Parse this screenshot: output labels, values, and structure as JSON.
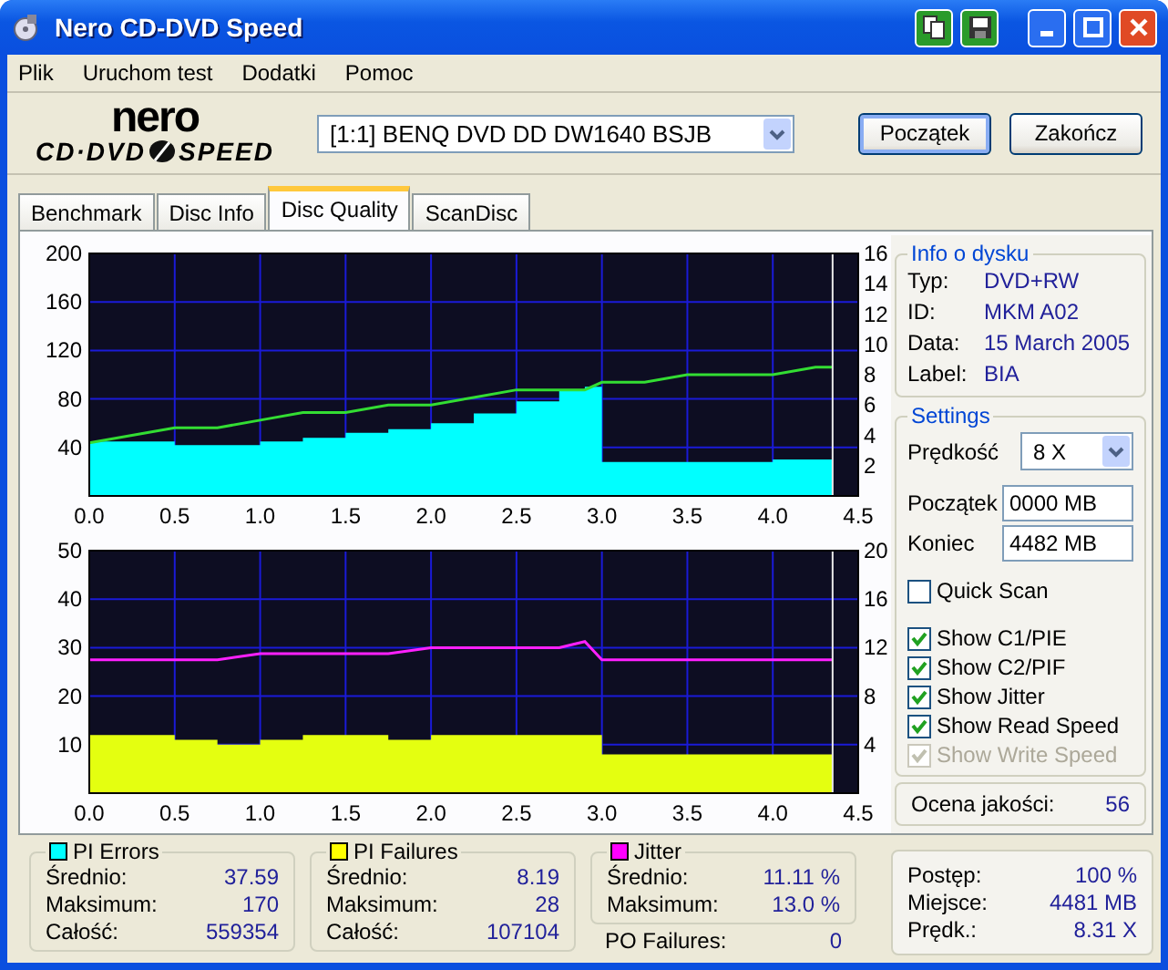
{
  "window": {
    "title": "Nero CD-DVD Speed"
  },
  "menu": [
    "Plik",
    "Uruchom test",
    "Dodatki",
    "Pomoc"
  ],
  "logo": {
    "top": "nero",
    "left": "CD·DVD",
    "right": "SPEED"
  },
  "drive": "[1:1]   BENQ DVD DD DW1640 BSJB",
  "buttons": [
    "Początek",
    "Zakończ"
  ],
  "tabs": [
    {
      "label": "Benchmark",
      "selected": false
    },
    {
      "label": "Disc Info",
      "selected": false
    },
    {
      "label": "Disc Quality",
      "selected": true
    },
    {
      "label": "ScanDisc",
      "selected": false
    }
  ],
  "charts": [
    {
      "chart_data": {
        "type": "area",
        "x": [
          0,
          0.25,
          0.5,
          0.75,
          1,
          1.25,
          1.5,
          1.75,
          2,
          2.25,
          2.5,
          2.75,
          2.9,
          3,
          3.25,
          3.5,
          3.75,
          4,
          4.25,
          4.35
        ],
        "xlim": [
          0,
          4.5
        ],
        "ylim": [
          0,
          200
        ],
        "y2lim": [
          0,
          16
        ],
        "xticks": [
          {
            "value": 0,
            "label": "0.0"
          },
          {
            "value": 0.5,
            "label": "0.5"
          },
          {
            "value": 1,
            "label": "1.0"
          },
          {
            "value": 1.5,
            "label": "1.5"
          },
          {
            "value": 2,
            "label": "2.0"
          },
          {
            "value": 2.5,
            "label": "2.5"
          },
          {
            "value": 3,
            "label": "3.0"
          },
          {
            "value": 3.5,
            "label": "3.5"
          },
          {
            "value": 4,
            "label": "4.0"
          },
          {
            "value": 4.5,
            "label": "4.5"
          }
        ],
        "yticks": [
          40,
          80,
          120,
          160,
          200
        ],
        "grid": true,
        "ref_lines": [
          {
            "axis": "x",
            "value": 4.35,
            "color": "#e8e8e8"
          }
        ],
        "y2ticks": [
          2,
          4,
          6,
          8,
          10,
          12,
          14,
          16
        ],
        "series": [
          {
            "color": "#00ffff",
            "values": [
              45,
              45,
              42,
              42,
              45,
              48,
              52,
              55,
              60,
              68,
              78,
              88,
              90,
              28,
              28,
              28,
              28,
              30,
              30,
              30
            ]
          },
          {
            "color": "#33dd33",
            "type": "line",
            "axis": "y2",
            "values": [
              3.5,
              4,
              4.5,
              4.5,
              5,
              5.5,
              5.5,
              6,
              6,
              6.5,
              7,
              7,
              7,
              7.5,
              7.5,
              8,
              8,
              8,
              8.5,
              8.5
            ]
          }
        ]
      }
    },
    {
      "chart_data": {
        "type": "area",
        "x": [
          0,
          0.25,
          0.5,
          0.75,
          1,
          1.25,
          1.5,
          1.75,
          2,
          2.25,
          2.5,
          2.75,
          2.9,
          3,
          3.25,
          3.5,
          3.75,
          4,
          4.25,
          4.35
        ],
        "xlim": [
          0,
          4.5
        ],
        "ylim": [
          0,
          50
        ],
        "y2lim": [
          0,
          20
        ],
        "xticks": [
          {
            "value": 0,
            "label": "0.0"
          },
          {
            "value": 0.5,
            "label": "0.5"
          },
          {
            "value": 1,
            "label": "1.0"
          },
          {
            "value": 1.5,
            "label": "1.5"
          },
          {
            "value": 2,
            "label": "2.0"
          },
          {
            "value": 2.5,
            "label": "2.5"
          },
          {
            "value": 3,
            "label": "3.0"
          },
          {
            "value": 3.5,
            "label": "3.5"
          },
          {
            "value": 4,
            "label": "4.0"
          },
          {
            "value": 4.5,
            "label": "4.5"
          }
        ],
        "yticks": [
          10,
          20,
          30,
          40,
          50
        ],
        "grid": true,
        "ref_lines": [
          {
            "axis": "x",
            "value": 4.35,
            "color": "#e8e8e8"
          }
        ],
        "y2ticks": [
          4,
          8,
          12,
          16,
          20
        ],
        "series": [
          {
            "color": "#e4ff10",
            "values": [
              12,
              12,
              11,
              10,
              11,
              12,
              12,
              11,
              12,
              12,
              12,
              12,
              12,
              8,
              8,
              8,
              8,
              8,
              8,
              8
            ]
          },
          {
            "color": "#ff20ff",
            "type": "line",
            "axis": "y2",
            "values": [
              11,
              11,
              11,
              11,
              11.5,
              11.5,
              11.5,
              11.5,
              12,
              12,
              12,
              12,
              12.5,
              11,
              11,
              11,
              11,
              11,
              11,
              11
            ]
          }
        ]
      }
    }
  ],
  "disc_info": {
    "title": "Info o dysku",
    "rows": [
      {
        "label": "Typ:",
        "value": "DVD+RW"
      },
      {
        "label": "ID:",
        "value": "MKM A02"
      },
      {
        "label": "Data:",
        "value": "15 March 2005"
      },
      {
        "label": "Label:",
        "value": "BIA"
      }
    ]
  },
  "settings": {
    "title": "Settings",
    "speed": {
      "label": "Prędkość",
      "value": "8 X"
    },
    "start": {
      "label": "Początek",
      "value": "0000 MB"
    },
    "end": {
      "label": "Koniec",
      "value": "4482 MB"
    },
    "quick_scan": {
      "label": "Quick Scan",
      "checked": false,
      "disabled": false
    },
    "options": [
      {
        "label": "Show C1/PIE",
        "checked": true,
        "disabled": false
      },
      {
        "label": "Show C2/PIF",
        "checked": true,
        "disabled": false
      },
      {
        "label": "Show Jitter",
        "checked": true,
        "disabled": false
      },
      {
        "label": "Show Read Speed",
        "checked": true,
        "disabled": false
      },
      {
        "label": "Show Write Speed",
        "checked": true,
        "disabled": true
      }
    ]
  },
  "quality": {
    "label": "Ocena jakości:",
    "value": "56"
  },
  "stats": [
    {
      "title": "PI Errors",
      "color": "#00ffff",
      "rows": [
        {
          "label": "Średnio:",
          "value": "37.59"
        },
        {
          "label": "Maksimum:",
          "value": "170"
        },
        {
          "label": "Całość:",
          "value": "559354"
        }
      ]
    },
    {
      "title": "PI Failures",
      "color": "#ffff00",
      "rows": [
        {
          "label": "Średnio:",
          "value": "8.19"
        },
        {
          "label": "Maksimum:",
          "value": "28"
        },
        {
          "label": "Całość:",
          "value": "107104"
        }
      ]
    },
    {
      "title": "Jitter",
      "color": "#ff00ff",
      "rows": [
        {
          "label": "Średnio:",
          "value": "11.11 %"
        },
        {
          "label": "Maksimum:",
          "value": "13.0 %"
        }
      ]
    }
  ],
  "po_failures": {
    "label": "PO Failures:",
    "value": "0"
  },
  "progress": [
    {
      "label": "Postęp:",
      "value": "100 %"
    },
    {
      "label": "Miejsce:",
      "value": "4481 MB"
    },
    {
      "label": "Prędk.:",
      "value": "8.31 X"
    }
  ]
}
